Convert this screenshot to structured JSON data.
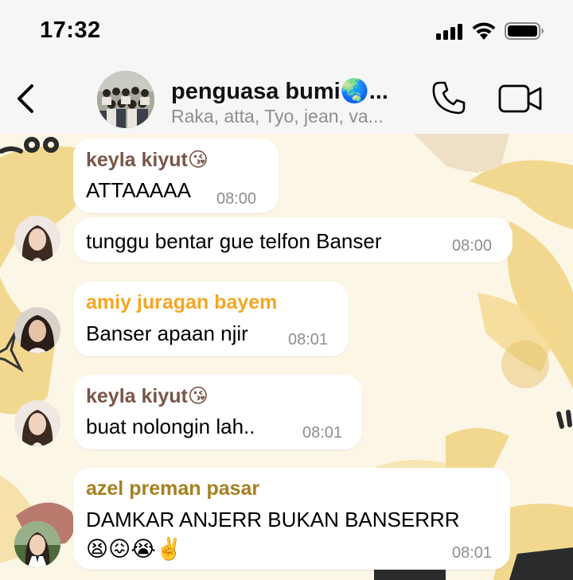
{
  "status_bar": {
    "time": "17:32"
  },
  "header": {
    "back_icon": "chevron-left-icon",
    "title": "penguasa bumi🌏...",
    "subtitle": "Raka, atta, Tyo, jean, va...",
    "call_icon": "phone-icon",
    "video_icon": "video-camera-icon"
  },
  "colors": {
    "header_bg": "#f6f6f6",
    "bubble_bg": "#ffffff",
    "sender_keyla": "#7a5548",
    "sender_amiy": "#f5a623",
    "sender_azel": "#a6801f"
  },
  "messages": [
    {
      "sender": "keyla kiyut😘",
      "text": "ATTAAAAA",
      "time": "08:00"
    },
    {
      "sender": "",
      "text": "tunggu bentar gue telfon Banser",
      "time": "08:00"
    },
    {
      "sender": "amiy juragan bayem",
      "text": "Banser apaan njir",
      "time": "08:01"
    },
    {
      "sender": "keyla kiyut😘",
      "text": "buat nolongin lah..",
      "time": "08:01"
    },
    {
      "sender": "azel preman pasar",
      "text": "DAMKAR ANJERR BUKAN BANSERRR",
      "text2": "😫😖😭✌️",
      "time": "08:01"
    }
  ]
}
